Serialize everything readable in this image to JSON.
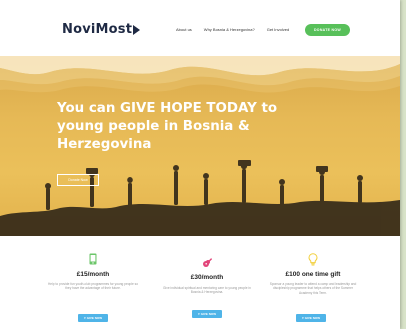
{
  "header": {
    "logo": "NoviMost",
    "nav": [
      "About us",
      "Why Bosnia & Herzegovina?",
      "Get Involved"
    ],
    "donate_label": "DONATE NOW"
  },
  "hero": {
    "title": "You can GIVE HOPE TODAY to young people in Bosnia & Herzegovina",
    "button_label": "Donate Now"
  },
  "cards": [
    {
      "icon": "phone-icon",
      "price": "£15/month",
      "description": "Help to provide fun youth-club programmes for young people so they have the advantage of their future.",
      "button_label": "GIVE NOW"
    },
    {
      "icon": "guitar-icon",
      "price": "£30/month",
      "description": "Give individual spiritual and mentoring care to young people in Bosnia & Herzegovina.",
      "button_label": "GIVE NOW"
    },
    {
      "icon": "lightbulb-icon",
      "price": "£100 one time gift",
      "description": "Sponsor a young leader to attend a camp and leadership and discipleship programme that helps others of the Summer Academy this Term.",
      "button_label": "GIVE NOW"
    }
  ],
  "colors": {
    "navy": "#1f2a44",
    "green": "#58c05a",
    "gold": "#e6b956",
    "blue": "#4fb4e8",
    "pink": "#e2457a"
  }
}
